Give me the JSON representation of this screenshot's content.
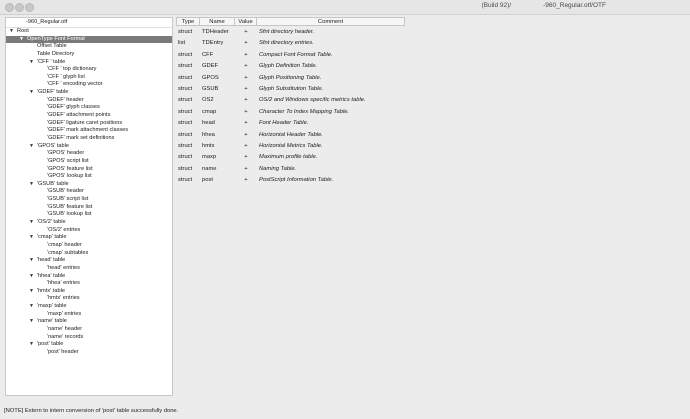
{
  "window": {
    "title_prefix": "(Build 92)/",
    "title_suffix": "-960_Regular.otf/OTF"
  },
  "tree": {
    "file_name": "-960_Regular.otf",
    "rows": [
      {
        "label": "Root",
        "depth": 0,
        "arrow": "expanded"
      },
      {
        "label": "OpenType Font Format",
        "depth": 1,
        "arrow": "expanded",
        "selected": true
      },
      {
        "label": "Offset Table",
        "depth": 2,
        "arrow": "none"
      },
      {
        "label": "Table Directory",
        "depth": 2,
        "arrow": "none"
      },
      {
        "label": "'CFF ' table",
        "depth": 2,
        "arrow": "expanded"
      },
      {
        "label": "'CFF ' top dictionary",
        "depth": 3,
        "arrow": "none"
      },
      {
        "label": "'CFF ' glyph list",
        "depth": 3,
        "arrow": "none"
      },
      {
        "label": "'CFF ' encoding vector",
        "depth": 3,
        "arrow": "none"
      },
      {
        "label": "'GDEF' table",
        "depth": 2,
        "arrow": "expanded"
      },
      {
        "label": "'GDEF' header",
        "depth": 3,
        "arrow": "none"
      },
      {
        "label": "'GDEF' glyph classes",
        "depth": 3,
        "arrow": "none"
      },
      {
        "label": "'GDEF' attachment points",
        "depth": 3,
        "arrow": "none"
      },
      {
        "label": "'GDEF' ligature caret positions",
        "depth": 3,
        "arrow": "none"
      },
      {
        "label": "'GDEF' mark attachment classes",
        "depth": 3,
        "arrow": "none"
      },
      {
        "label": "'GDEF' mark set definitions",
        "depth": 3,
        "arrow": "none"
      },
      {
        "label": "'GPOS' table",
        "depth": 2,
        "arrow": "expanded"
      },
      {
        "label": "'GPOS' header",
        "depth": 3,
        "arrow": "none"
      },
      {
        "label": "'GPOS' script list",
        "depth": 3,
        "arrow": "none"
      },
      {
        "label": "'GPOS' feature list",
        "depth": 3,
        "arrow": "none"
      },
      {
        "label": "'GPOS' lookup list",
        "depth": 3,
        "arrow": "none"
      },
      {
        "label": "'GSUB' table",
        "depth": 2,
        "arrow": "expanded"
      },
      {
        "label": "'GSUB' header",
        "depth": 3,
        "arrow": "none"
      },
      {
        "label": "'GSUB' script list",
        "depth": 3,
        "arrow": "none"
      },
      {
        "label": "'GSUB' feature list",
        "depth": 3,
        "arrow": "none"
      },
      {
        "label": "'GSUB' lookup list",
        "depth": 3,
        "arrow": "none"
      },
      {
        "label": "'OS/2' table",
        "depth": 2,
        "arrow": "expanded"
      },
      {
        "label": "'OS/2' entries",
        "depth": 3,
        "arrow": "none"
      },
      {
        "label": "'cmap' table",
        "depth": 2,
        "arrow": "expanded"
      },
      {
        "label": "'cmap' header",
        "depth": 3,
        "arrow": "none"
      },
      {
        "label": "'cmap' subtables",
        "depth": 3,
        "arrow": "none"
      },
      {
        "label": "'head' table",
        "depth": 2,
        "arrow": "expanded"
      },
      {
        "label": "'head' entries",
        "depth": 3,
        "arrow": "none"
      },
      {
        "label": "'hhea' table",
        "depth": 2,
        "arrow": "expanded"
      },
      {
        "label": "'hhea' entries",
        "depth": 3,
        "arrow": "none"
      },
      {
        "label": "'hmtx' table",
        "depth": 2,
        "arrow": "expanded"
      },
      {
        "label": "'hmtx' entries",
        "depth": 3,
        "arrow": "none"
      },
      {
        "label": "'maxp' table",
        "depth": 2,
        "arrow": "expanded"
      },
      {
        "label": "'maxp' entries",
        "depth": 3,
        "arrow": "none"
      },
      {
        "label": "'name' table",
        "depth": 2,
        "arrow": "expanded"
      },
      {
        "label": "'name' header",
        "depth": 3,
        "arrow": "none"
      },
      {
        "label": "'name' records",
        "depth": 3,
        "arrow": "none"
      },
      {
        "label": "'post' table",
        "depth": 2,
        "arrow": "expanded"
      },
      {
        "label": "'post' header",
        "depth": 3,
        "arrow": "none"
      }
    ]
  },
  "table": {
    "columns": [
      "Type",
      "Name",
      "Value",
      "Comment"
    ],
    "rows": [
      {
        "type": "struct",
        "name": "TDHeader",
        "value": "+",
        "comment": "Sfnt directory header."
      },
      {
        "type": "list",
        "name": "TDEntry",
        "value": "+",
        "comment": "Sfnt directory entries."
      },
      {
        "type": "struct",
        "name": "CFF",
        "value": "+",
        "comment": "Compact Font Format Table."
      },
      {
        "type": "struct",
        "name": "GDEF",
        "value": "+",
        "comment": "Glyph Definition Table."
      },
      {
        "type": "struct",
        "name": "GPOS",
        "value": "+",
        "comment": "Glyph Positioning Table."
      },
      {
        "type": "struct",
        "name": "GSUB",
        "value": "+",
        "comment": "Glyph Substitution Table."
      },
      {
        "type": "struct",
        "name": "OS2",
        "value": "+",
        "comment": "OS/2 and Windows specific metrics table."
      },
      {
        "type": "struct",
        "name": "cmap",
        "value": "+",
        "comment": "Character To Index Mapping Table."
      },
      {
        "type": "struct",
        "name": "head",
        "value": "+",
        "comment": "Font Header Table."
      },
      {
        "type": "struct",
        "name": "hhea",
        "value": "+",
        "comment": "Horizontal Header Table."
      },
      {
        "type": "struct",
        "name": "hmtx",
        "value": "+",
        "comment": "Horizontal Metrics Table."
      },
      {
        "type": "struct",
        "name": "maxp",
        "value": "+",
        "comment": "Maximum profile table."
      },
      {
        "type": "struct",
        "name": "name",
        "value": "+",
        "comment": "Naming Table."
      },
      {
        "type": "struct",
        "name": "post",
        "value": "+",
        "comment": "PostScript Information Table."
      }
    ]
  },
  "status": {
    "message": "[NOTE] Extern to intern conversion of 'post' table successfully done."
  }
}
